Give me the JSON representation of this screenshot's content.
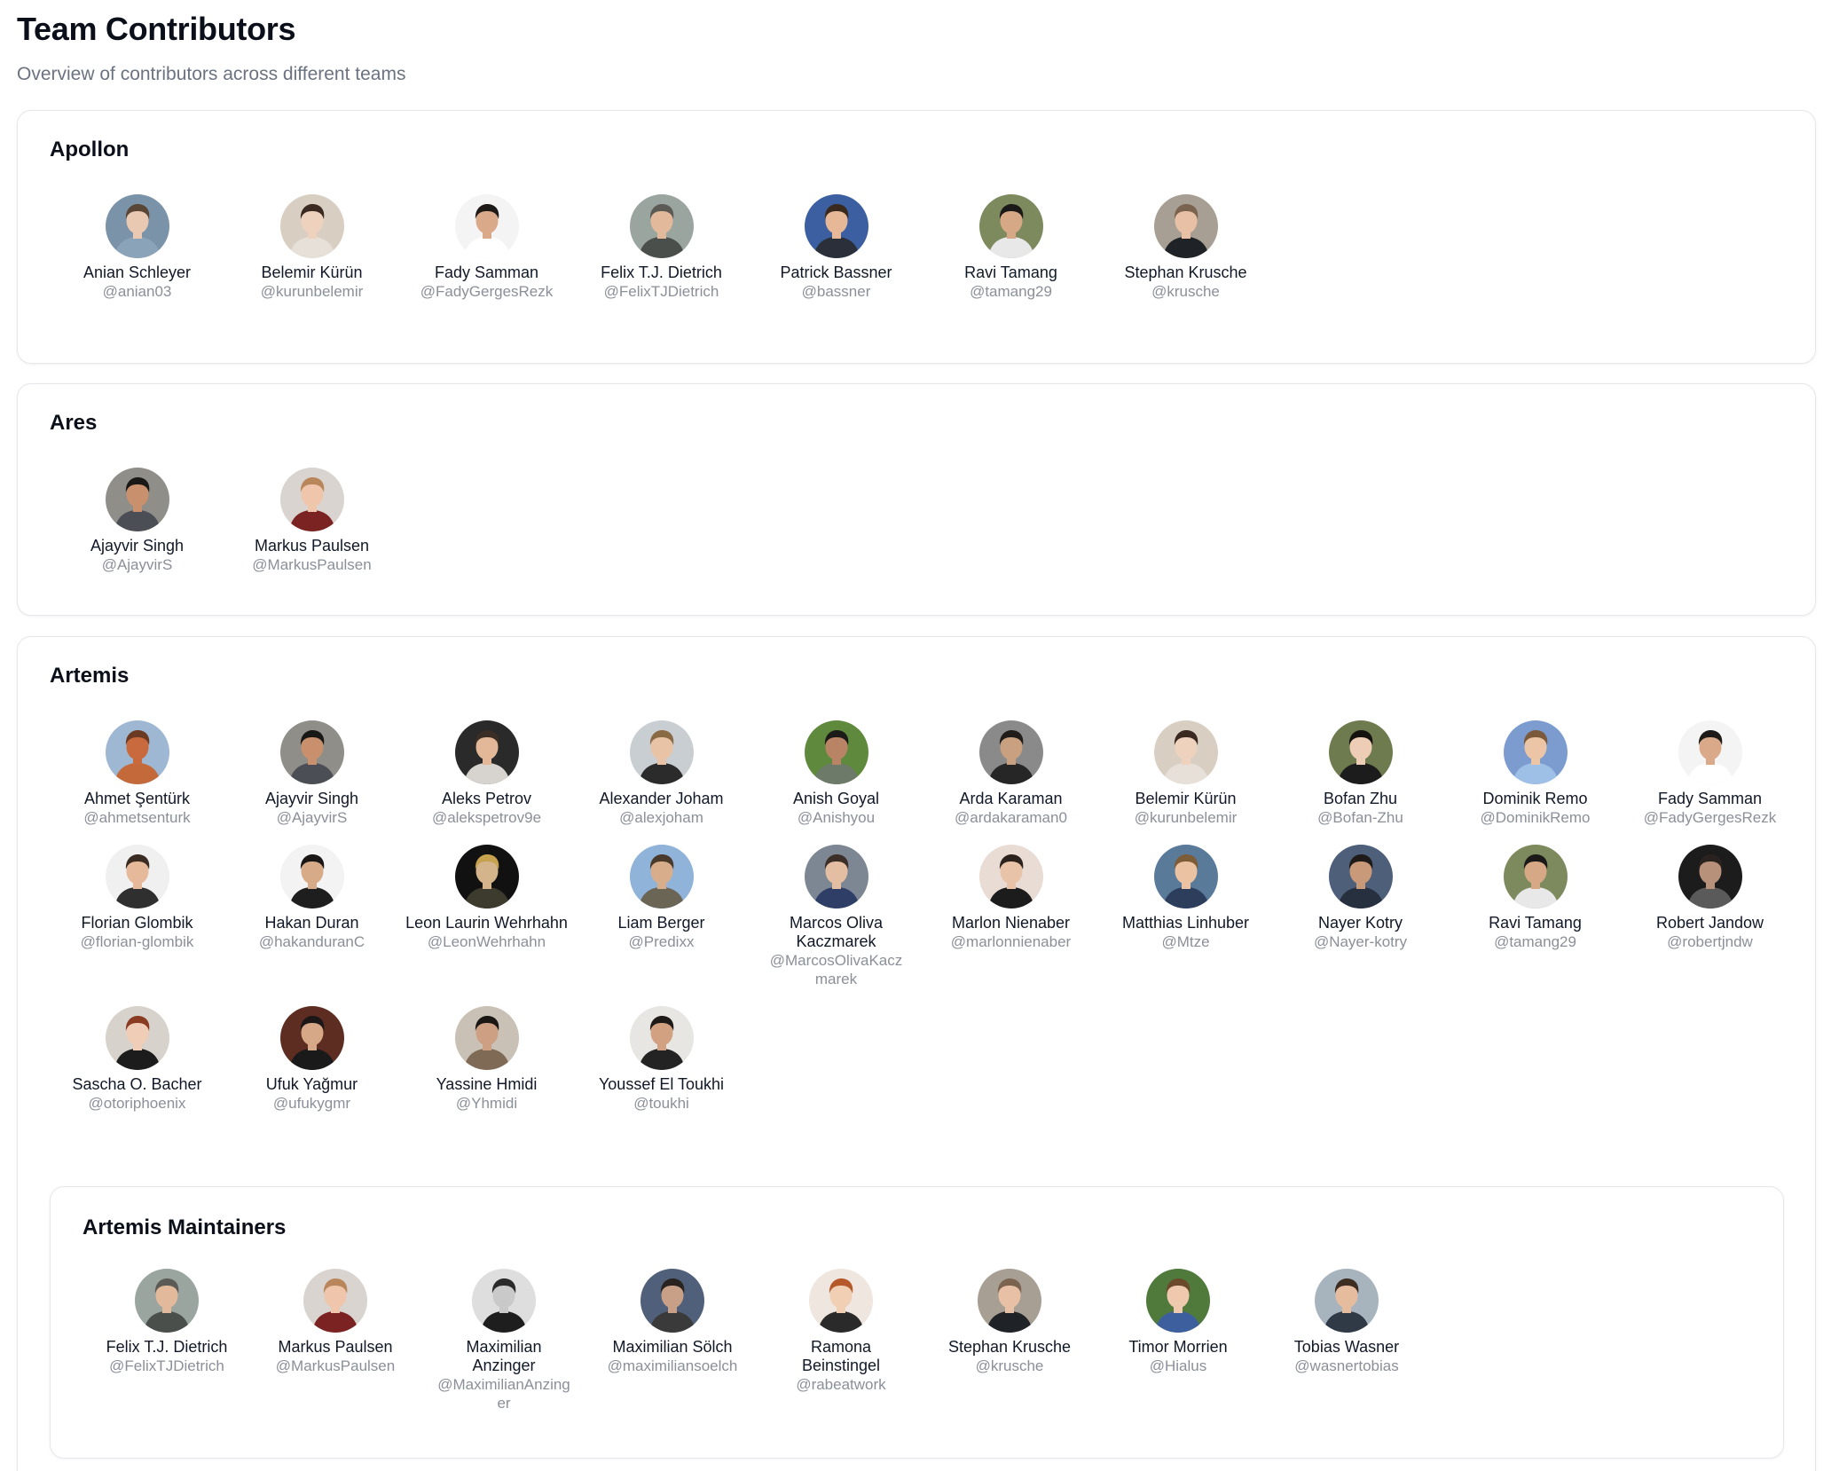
{
  "header": {
    "title": "Team Contributors",
    "subtitle": "Overview of contributors across different teams"
  },
  "teams": [
    {
      "name": "Apollon",
      "members": [
        {
          "name": "Anian Schleyer",
          "login": "@anian03",
          "bg": "#7a93a8",
          "skin": "#e9c9b2",
          "hair": "#5a4636",
          "shirt": "#8ba3b8"
        },
        {
          "name": "Belemir Kürün",
          "login": "@kurunbelemir",
          "bg": "#d8cfc2",
          "skin": "#efd2be",
          "hair": "#3a2a22",
          "shirt": "#e6e0d8"
        },
        {
          "name": "Fady Samman",
          "login": "@FadyGergesRezk",
          "bg": "#f4f4f4",
          "skin": "#d9a98a",
          "hair": "#1d1a18",
          "shirt": "#ffffff"
        },
        {
          "name": "Felix T.J. Dietrich",
          "login": "@FelixTJDietrich",
          "bg": "#9aa5a0",
          "skin": "#e2b99a",
          "hair": "#5c5a55",
          "shirt": "#4a4f4c"
        },
        {
          "name": "Patrick Bassner",
          "login": "@bassner",
          "bg": "#3b5fa0",
          "skin": "#e6b897",
          "hair": "#3a2a1e",
          "shirt": "#2a2f3a"
        },
        {
          "name": "Ravi Tamang",
          "login": "@tamang29",
          "bg": "#7d8a5e",
          "skin": "#d7a886",
          "hair": "#1c1a19",
          "shirt": "#e8e8e8"
        },
        {
          "name": "Stephan Krusche",
          "login": "@krusche",
          "bg": "#a89f94",
          "skin": "#e7c0a5",
          "hair": "#7a6450",
          "shirt": "#1f2328"
        }
      ]
    },
    {
      "name": "Ares",
      "members": [
        {
          "name": "Ajayvir Singh",
          "login": "@AjayvirS",
          "bg": "#8f8e89",
          "skin": "#c8906d",
          "hair": "#1a1816",
          "shirt": "#4b4f55"
        },
        {
          "name": "Markus Paulsen",
          "login": "@MarkusPaulsen",
          "bg": "#d9d4cf",
          "skin": "#efc6ab",
          "hair": "#b8865a",
          "shirt": "#7b2222"
        }
      ]
    },
    {
      "name": "Artemis",
      "members": [
        {
          "name": "Ahmet Şentürk",
          "login": "@ahmetsenturk",
          "bg": "#9eb8d4",
          "skin": "#c86a3d",
          "hair": "#6b3a22",
          "shirt": "#c4693a"
        },
        {
          "name": "Ajayvir Singh",
          "login": "@AjayvirS",
          "bg": "#8f8e89",
          "skin": "#c8906d",
          "hair": "#1a1816",
          "shirt": "#4b4f55"
        },
        {
          "name": "Aleks Petrov",
          "login": "@alekspetrov9e",
          "bg": "#2a2a2a",
          "skin": "#e3b899",
          "hair": "#3b2e24",
          "shirt": "#d7d3cf"
        },
        {
          "name": "Alexander Joham",
          "login": "@alexjoham",
          "bg": "#c9ced3",
          "skin": "#e9c3a5",
          "hair": "#8a6a44",
          "shirt": "#2b2b2b"
        },
        {
          "name": "Anish Goyal",
          "login": "@Anishyou",
          "bg": "#5f8a3d",
          "skin": "#b98466",
          "hair": "#1d1b1a",
          "shirt": "#6d7a6a"
        },
        {
          "name": "Arda Karaman",
          "login": "@ardakaraman0",
          "bg": "#8a8a8a",
          "skin": "#c9a080",
          "hair": "#1f1c1a",
          "shirt": "#262626"
        },
        {
          "name": "Belemir Kürün",
          "login": "@kurunbelemir",
          "bg": "#d8cfc2",
          "skin": "#efd2be",
          "hair": "#3a2a22",
          "shirt": "#e6e0d8"
        },
        {
          "name": "Bofan Zhu",
          "login": "@Bofan-Zhu",
          "bg": "#6e7b4e",
          "skin": "#edcdb6",
          "hair": "#15120f",
          "shirt": "#1c1c1c"
        },
        {
          "name": "Dominik Remo",
          "login": "@DominikRemo",
          "bg": "#7c9ccf",
          "skin": "#ecc4a6",
          "hair": "#7a5a3a",
          "shirt": "#9fc0e6"
        },
        {
          "name": "Fady Samman",
          "login": "@FadyGergesRezk",
          "bg": "#f4f4f4",
          "skin": "#d9a98a",
          "hair": "#1d1a18",
          "shirt": "#ffffff"
        },
        {
          "name": "Florian Glombik",
          "login": "@florian-glombik",
          "bg": "#f0f0f0",
          "skin": "#e6b99a",
          "hair": "#3a2c22",
          "shirt": "#2f2f2f"
        },
        {
          "name": "Hakan Duran",
          "login": "@hakanduranC",
          "bg": "#f3f3f3",
          "skin": "#d7aa88",
          "hair": "#1a1716",
          "shirt": "#1e1e1e"
        },
        {
          "name": "Leon Laurin Wehrhahn",
          "login": "@LeonWehrhahn",
          "bg": "#111111",
          "skin": "#d4b48a",
          "hair": "#c7a24e",
          "shirt": "#3d3a2e"
        },
        {
          "name": "Liam Berger",
          "login": "@Predixx",
          "bg": "#8fb3d9",
          "skin": "#d8ad8c",
          "hair": "#4a3a2c",
          "shirt": "#6b6556"
        },
        {
          "name": "Marcos Oliva Kaczmarek",
          "login": "@MarcosOlivaKaczmarek",
          "bg": "#7d8793",
          "skin": "#e3bea2",
          "hair": "#3b2f28",
          "shirt": "#2e3e66"
        },
        {
          "name": "Marlon Nienaber",
          "login": "@marlonnienaber",
          "bg": "#e8dcd4",
          "skin": "#e9c3a8",
          "hair": "#2b221d",
          "shirt": "#1c1c1c"
        },
        {
          "name": "Matthias Linhuber",
          "login": "@Mtze",
          "bg": "#5a7a9a",
          "skin": "#ebc3a2",
          "hair": "#7d5c38",
          "shirt": "#2c3e5c"
        },
        {
          "name": "Nayer Kotry",
          "login": "@Nayer-kotry",
          "bg": "#4e5f7a",
          "skin": "#c99a7a",
          "hair": "#1f1b18",
          "shirt": "#26303f"
        },
        {
          "name": "Ravi Tamang",
          "login": "@tamang29",
          "bg": "#7d8a5e",
          "skin": "#d7a886",
          "hair": "#1c1a19",
          "shirt": "#e8e8e8"
        },
        {
          "name": "Robert Jandow",
          "login": "@robertjndw",
          "bg": "#1c1c1c",
          "skin": "#b8917a",
          "hair": "#2a221e",
          "shirt": "#5a5a5a"
        },
        {
          "name": "Sascha O. Bacher",
          "login": "@otoriphoenix",
          "bg": "#d8d2cc",
          "skin": "#efcdb6",
          "hair": "#8a3c22",
          "shirt": "#1c1c1c"
        },
        {
          "name": "Ufuk Yağmur",
          "login": "@ufukygmr",
          "bg": "#5e2d22",
          "skin": "#d7a888",
          "hair": "#1b1817",
          "shirt": "#1a1a1a"
        },
        {
          "name": "Yassine Hmidi",
          "login": "@Yhmidi",
          "bg": "#c9c0b6",
          "skin": "#cda083",
          "hair": "#1a1715",
          "shirt": "#7e6a55"
        },
        {
          "name": "Youssef El Toukhi",
          "login": "@toukhi",
          "bg": "#e8e6e3",
          "skin": "#d2a182",
          "hair": "#1d1a18",
          "shirt": "#232323"
        }
      ],
      "subteam": {
        "name": "Artemis Maintainers",
        "members": [
          {
            "name": "Felix T.J. Dietrich",
            "login": "@FelixTJDietrich",
            "bg": "#9aa5a0",
            "skin": "#e2b99a",
            "hair": "#5c5a55",
            "shirt": "#4a4f4c"
          },
          {
            "name": "Markus Paulsen",
            "login": "@MarkusPaulsen",
            "bg": "#d9d4cf",
            "skin": "#efc6ab",
            "hair": "#b8865a",
            "shirt": "#7b2222"
          },
          {
            "name": "Maximilian Anzinger",
            "login": "@MaximilianAnzinger",
            "bg": "#dedede",
            "skin": "#c9c9c9",
            "hair": "#2a2a2a",
            "shirt": "#1e1e1e"
          },
          {
            "name": "Maximilian Sölch",
            "login": "@maximiliansoelch",
            "bg": "#50607a",
            "skin": "#c8a088",
            "hair": "#2a2420",
            "shirt": "#3a3a3a"
          },
          {
            "name": "Ramona Beinstingel",
            "login": "@rabeatwork",
            "bg": "#efe6df",
            "skin": "#f0cfb5",
            "hair": "#b5582a",
            "shirt": "#2a2a2a"
          },
          {
            "name": "Stephan Krusche",
            "login": "@krusche",
            "bg": "#a89f94",
            "skin": "#e7c0a5",
            "hair": "#7a6450",
            "shirt": "#1f2328"
          },
          {
            "name": "Timor Morrien",
            "login": "@Hialus",
            "bg": "#4f7a3c",
            "skin": "#eec9ad",
            "hair": "#6b4a2c",
            "shirt": "#3e5f9e"
          },
          {
            "name": "Tobias Wasner",
            "login": "@wasnertobias",
            "bg": "#a7b3bd",
            "skin": "#e6bc9e",
            "hair": "#3e2e22",
            "shirt": "#2f3a46"
          }
        ]
      }
    }
  ]
}
